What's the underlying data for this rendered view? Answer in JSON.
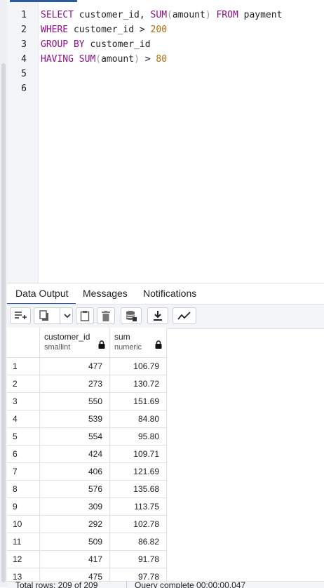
{
  "editor": {
    "line_numbers": [
      "1",
      "2",
      "3",
      "4",
      "5",
      "6"
    ]
  },
  "query": {
    "kw_select": "SELECT",
    "select_rest_a": " customer_id, ",
    "kw_sum": "SUM",
    "paren_open": "(",
    "arg_amount": "amount",
    "paren_close": ")",
    "kw_from": "FROM",
    "table": " payment",
    "kw_where": "WHERE",
    "where_rest": " customer_id > ",
    "where_value": "200",
    "kw_group_by": "GROUP BY",
    "group_rest": " customer_id",
    "kw_having": "HAVING",
    "having_rest": " > ",
    "having_value": "80"
  },
  "tabs": {
    "data_output": "Data Output",
    "messages": "Messages",
    "notifications": "Notifications"
  },
  "toolbar": {
    "icons": [
      "add-row-icon",
      "copy-icon",
      "chevron-down-icon",
      "paste-icon",
      "delete-icon",
      "save-data-icon",
      "download-icon",
      "graph-icon"
    ]
  },
  "grid": {
    "columns": [
      {
        "name": "customer_id",
        "type": "smallint"
      },
      {
        "name": "sum",
        "type": "numeric"
      }
    ],
    "rows": [
      [
        "1",
        "477",
        "106.79"
      ],
      [
        "2",
        "273",
        "130.72"
      ],
      [
        "3",
        "550",
        "151.69"
      ],
      [
        "4",
        "539",
        "84.80"
      ],
      [
        "5",
        "554",
        "95.80"
      ],
      [
        "6",
        "424",
        "109.71"
      ],
      [
        "7",
        "406",
        "121.69"
      ],
      [
        "8",
        "576",
        "135.68"
      ],
      [
        "9",
        "309",
        "113.75"
      ],
      [
        "10",
        "292",
        "102.78"
      ],
      [
        "11",
        "509",
        "86.82"
      ],
      [
        "12",
        "417",
        "91.78"
      ],
      [
        "13",
        "475",
        "97.78"
      ]
    ]
  },
  "status": {
    "total_rows": "Total rows: 209 of 209",
    "query_complete": "Query complete 00:00:00.047"
  },
  "colors": {
    "keyword": "#8a0e8a",
    "number": "#b16a0a",
    "accent": "#2c5aa0"
  }
}
